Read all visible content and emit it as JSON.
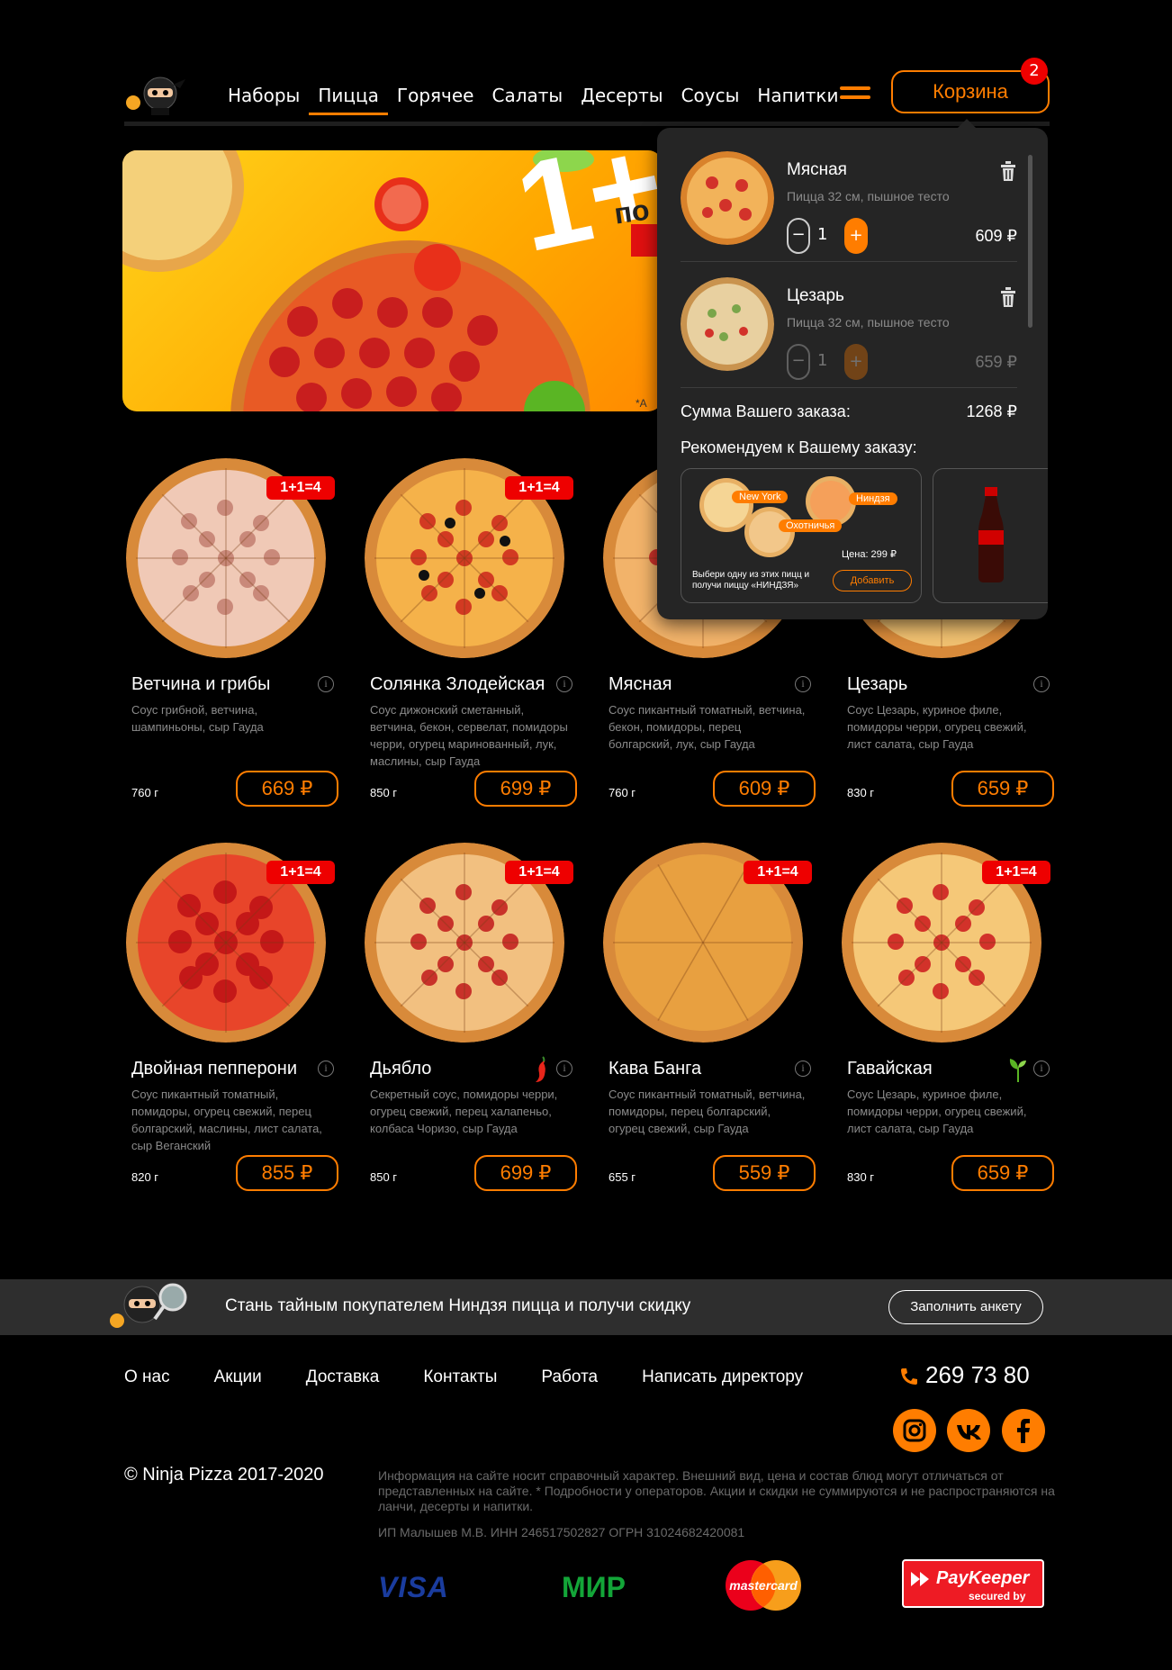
{
  "header": {
    "nav": [
      "Наборы",
      "Пицца",
      "Горячее",
      "Салаты",
      "Десерты",
      "Соусы",
      "Напитки"
    ],
    "active_nav": "Пицца",
    "cart_label": "Корзина",
    "cart_count": "2"
  },
  "banner": {
    "text": "1+",
    "visible_fragment_top": "по",
    "note": "*А"
  },
  "cart_dropdown": {
    "items": [
      {
        "name": "Мясная",
        "desc": "Пицца 32 см, пышное тесто",
        "qty": "1",
        "price": "609 ₽",
        "minus": "−",
        "plus": "+"
      },
      {
        "name": "Цезарь",
        "desc": "Пицца 32 см, пышное тесто",
        "qty": "1",
        "price": "659 ₽",
        "minus": "−",
        "plus": "+"
      }
    ],
    "sum_label": "Сумма Вашего заказа:",
    "sum_value": "1268 ₽",
    "recommend_title": "Рекомендуем к Вашему заказу:",
    "rec_tags": [
      "New York",
      "Ниндзя",
      "Охотничья"
    ],
    "rec_price": "Цена: 299 ₽",
    "rec_text": "Выбери одну из этих пицц и получи пиццу «НИНДЗЯ»",
    "rec_add": "Добавить"
  },
  "products": [
    {
      "name": "Ветчина и грибы",
      "desc": "Соус грибной, ветчина, шампиньоны, сыр Гауда",
      "weight": "760 г",
      "price": "669 ₽",
      "promo": "1+1=4"
    },
    {
      "name": "Солянка Злодейская",
      "desc": "Соус дижонский сметанный, ветчина, бекон, сервелат, помидоры черри, огурец маринованный, лук, маслины, сыр Гауда",
      "weight": "850 г",
      "price": "699 ₽",
      "promo": "1+1=4"
    },
    {
      "name": "Мясная",
      "desc": "Соус пикантный томатный, ветчина, бекон, помидоры, перец болгарский, лук, сыр Гауда",
      "weight": "760 г",
      "price": "609 ₽",
      "promo": ""
    },
    {
      "name": "Цезарь",
      "desc": "Соус Цезарь, куриное филе, помидоры черри, огурец свежий, лист салата, сыр Гауда",
      "weight": "830 г",
      "price": "659 ₽",
      "promo": ""
    },
    {
      "name": "Двойная пепперони",
      "desc": "Соус пикантный томатный, помидоры, огурец свежий, перец болгарский, маслины, лист салата, сыр Веганский",
      "weight": "820 г",
      "price": "855 ₽",
      "promo": "1+1=4"
    },
    {
      "name": "Дьябло",
      "desc": "Секретный соус, помидоры черри, огурец свежий, перец халапеньо, колбаса Чоризо, сыр Гауда",
      "weight": "850 г",
      "price": "699 ₽",
      "promo": "1+1=4"
    },
    {
      "name": "Кава Банга",
      "desc": "Соус пикантный томатный, ветчина, помидоры, перец болгарский, огурец свежий, сыр Гауда",
      "weight": "655 г",
      "price": "559 ₽",
      "promo": "1+1=4"
    },
    {
      "name": "Гавайская",
      "desc": "Соус Цезарь, куриное филе, помидоры черри, огурец свежий, лист салата, сыр Гауда",
      "weight": "830 г",
      "price": "659 ₽",
      "promo": "1+1=4"
    }
  ],
  "info_glyph": "i",
  "mystery": {
    "text": "Стань тайным покупателем Ниндзя пицца и получи скидку",
    "button": "Заполнить анкету"
  },
  "footer": {
    "nav": [
      "О нас",
      "Акции",
      "Доставка",
      "Контакты",
      "Работа",
      "Написать директору"
    ],
    "phone": "269 73 80",
    "copyright": "© Ninja Pizza 2017-2020",
    "legal": "Информация на сайте носит справочный характер. Внешний вид, цена и состав блюд могут отличаться от представленных на сайте. * Подробности у операторов. Акции и скидки не суммируются и не распространяются на ланчи, десерты и напитки.",
    "ip": "ИП Малышев М.В. ИНН 246517502827 ОГРН 31024682420081",
    "payments": {
      "visa": "VISA",
      "mir": "МИР",
      "mastercard": "mastercard",
      "paykeeper": "PayKeeper",
      "paykeeper_sub": "secured by"
    }
  },
  "colors": {
    "accent": "#ff7d00",
    "promo": "#e00000",
    "bg": "#000000",
    "panel": "#252525"
  },
  "icons": [
    "ninja-logo-icon",
    "burger-menu-icon",
    "trash-icon",
    "info-icon",
    "chili-icon",
    "leaf-icon",
    "phone-icon",
    "instagram-icon",
    "vk-icon",
    "facebook-icon",
    "magnifier-icon"
  ]
}
